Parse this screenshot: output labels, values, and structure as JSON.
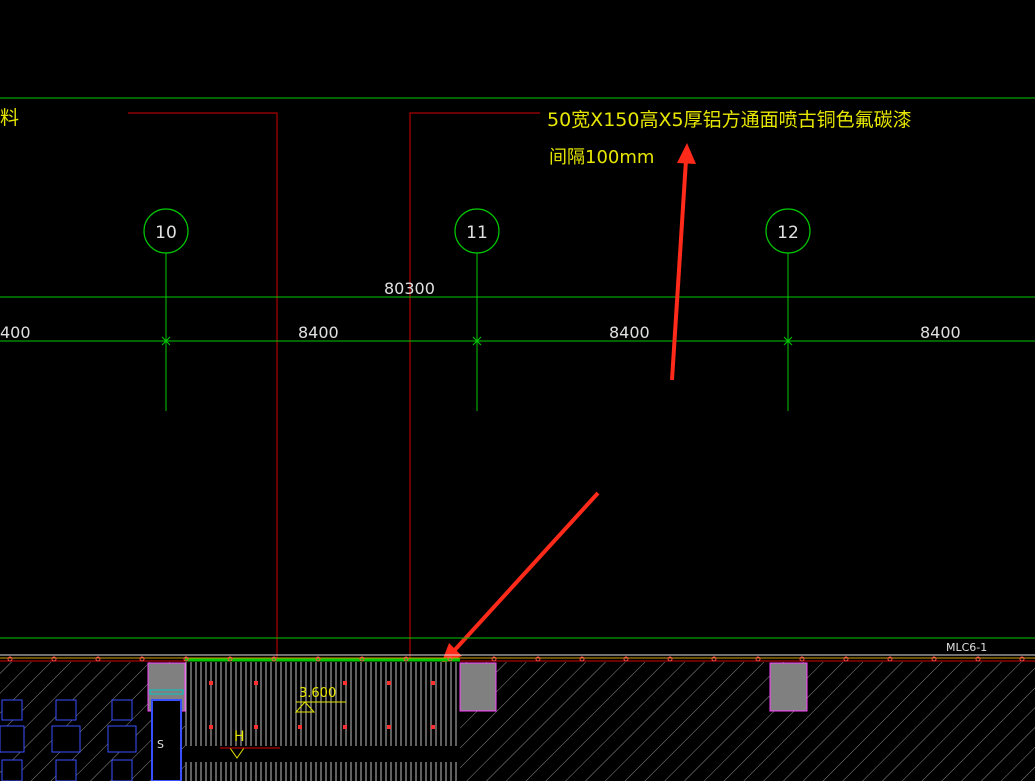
{
  "colors": {
    "background": "#000000",
    "axis_green": "#00c800",
    "red_line": "#d40000",
    "annotation_yellow": "#e6e600",
    "dim_text": "#e0e0e0",
    "arrow_red": "#ff2a1a",
    "column_fill": "#808080",
    "column_edge": "#ff40ff",
    "hatch": "#8a8a8a",
    "furniture": "#3a4fff"
  },
  "annotation": {
    "line1": "50宽X150高X5厚铝方通面喷古铜色氟碳漆",
    "line2": "间隔100mm",
    "left_fragment": "料"
  },
  "axes": [
    {
      "label": "10"
    },
    {
      "label": "11"
    },
    {
      "label": "12"
    }
  ],
  "dimensions": {
    "overall": "80300",
    "bays": [
      "400",
      "8400",
      "8400",
      "8400"
    ]
  },
  "tags": {
    "door": "MLC6-1",
    "elevation": "3.600",
    "h_mark": "H",
    "s_mark": "S"
  }
}
